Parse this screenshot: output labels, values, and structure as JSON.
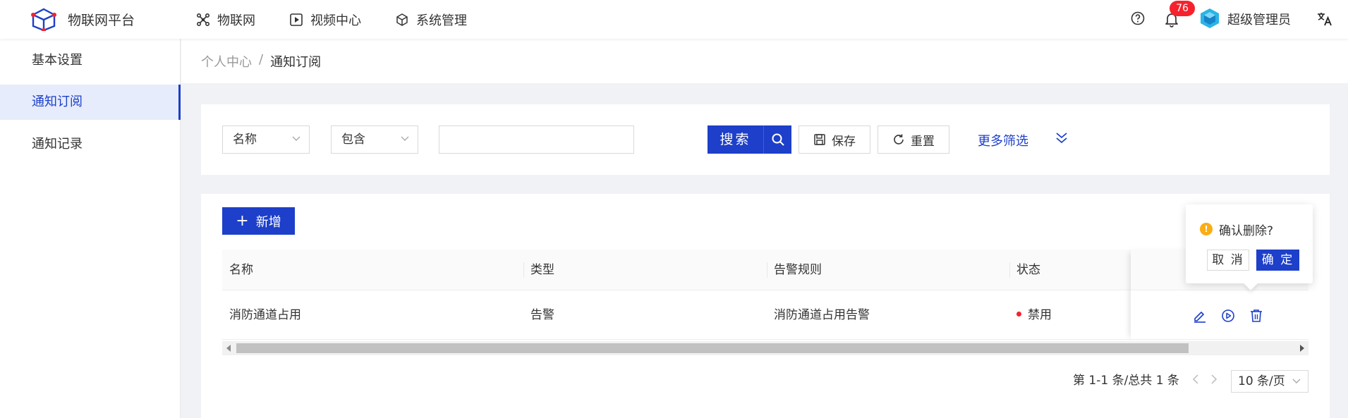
{
  "header": {
    "app_name": "物联网平台",
    "nav": [
      {
        "label": "物联网",
        "icon": "iot-icon"
      },
      {
        "label": "视频中心",
        "icon": "play-icon"
      },
      {
        "label": "系统管理",
        "icon": "cube-icon"
      }
    ],
    "notification_count": "76",
    "username": "超级管理员"
  },
  "sidebar": {
    "items": [
      {
        "label": "基本设置",
        "active": false
      },
      {
        "label": "通知订阅",
        "active": true
      },
      {
        "label": "通知记录",
        "active": false
      }
    ]
  },
  "breadcrumb": {
    "parent": "个人中心",
    "separator": "/",
    "current": "通知订阅"
  },
  "filter": {
    "field_select": "名称",
    "operator_select": "包含",
    "value": "",
    "search_label": "搜索",
    "save_label": "保存",
    "reset_label": "重置",
    "more_filter_label": "更多筛选"
  },
  "toolbar": {
    "add_label": "新增"
  },
  "table": {
    "columns": [
      "名称",
      "类型",
      "告警规则",
      "状态"
    ],
    "rows": [
      {
        "name": "消防通道占用",
        "type": "告警",
        "rule": "消防通道占用告警",
        "status": "禁用"
      }
    ]
  },
  "pagination": {
    "summary": "第 1-1 条/总共 1 条",
    "page_size": "10 条/页"
  },
  "popconfirm": {
    "title": "确认删除?",
    "cancel_label": "取 消",
    "ok_label": "确 定"
  },
  "colors": {
    "primary": "#1d3fc9",
    "danger": "#f5222d",
    "warning": "#faad14"
  }
}
